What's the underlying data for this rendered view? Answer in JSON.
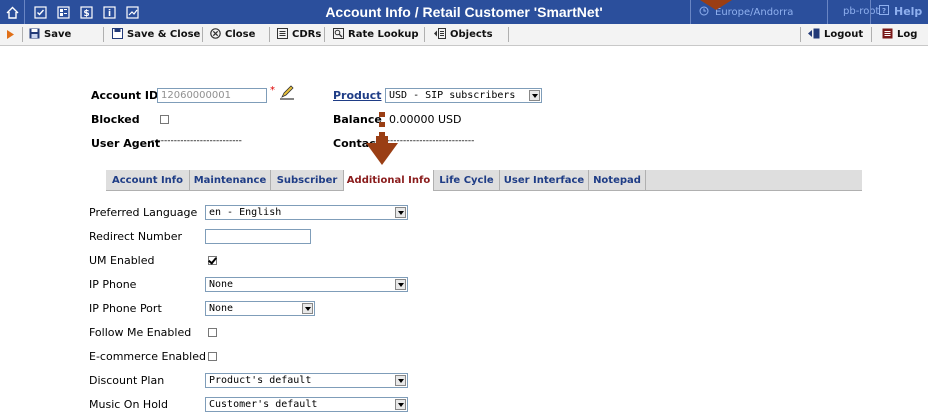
{
  "titlebar": {
    "title": "Account Info / Retail Customer 'SmartNet'",
    "timezone": "Europe/Andorra",
    "user": "pb-root",
    "help_label": "Help",
    "icons": [
      "home-icon",
      "checkbox-icon",
      "grid-icon",
      "dollar-icon",
      "info-icon",
      "chart-icon"
    ]
  },
  "toolbar": {
    "save": "Save",
    "save_close": "Save & Close",
    "close": "Close",
    "cdrs": "CDRs",
    "rate_lookup": "Rate Lookup",
    "objects": "Objects",
    "logout": "Logout",
    "log": "Log"
  },
  "header": {
    "account_id_label": "Account ID",
    "account_id_value": "12060000001",
    "required_mark": "*",
    "product_label": "Product",
    "product_value": "USD - SIP subscribers",
    "blocked_label": "Blocked",
    "balance_label": "Balance",
    "balance_value": "0.00000 USD",
    "user_agent_label": "User Agent",
    "user_agent_value": "----------------------------",
    "contact_label": "Contact",
    "contact_value": "------------------------------"
  },
  "tabs": [
    "Account Info",
    "Maintenance",
    "Subscriber",
    "Additional Info",
    "Life Cycle",
    "User Interface",
    "Notepad"
  ],
  "active_tab": "Additional Info",
  "form": {
    "preferred_language_label": "Preferred Language",
    "preferred_language_value": "en - English",
    "redirect_number_label": "Redirect Number",
    "redirect_number_value": "",
    "um_enabled_label": "UM Enabled",
    "um_enabled_checked": true,
    "ip_phone_label": "IP Phone",
    "ip_phone_value": "None",
    "ip_phone_port_label": "IP Phone Port",
    "ip_phone_port_value": "None",
    "follow_me_label": "Follow Me Enabled",
    "follow_me_checked": false,
    "ecommerce_label": "E-commerce Enabled",
    "ecommerce_checked": false,
    "discount_plan_label": "Discount Plan",
    "discount_plan_value": "Product's default",
    "moh_label": "Music On Hold",
    "moh_value": "Customer's default"
  },
  "colors": {
    "titlebar_bg": "#2b4f9c",
    "tab_text": "#1f3d86",
    "active_tab_text": "#8a1c1c",
    "annotation_arrow": "#9a3e14"
  }
}
